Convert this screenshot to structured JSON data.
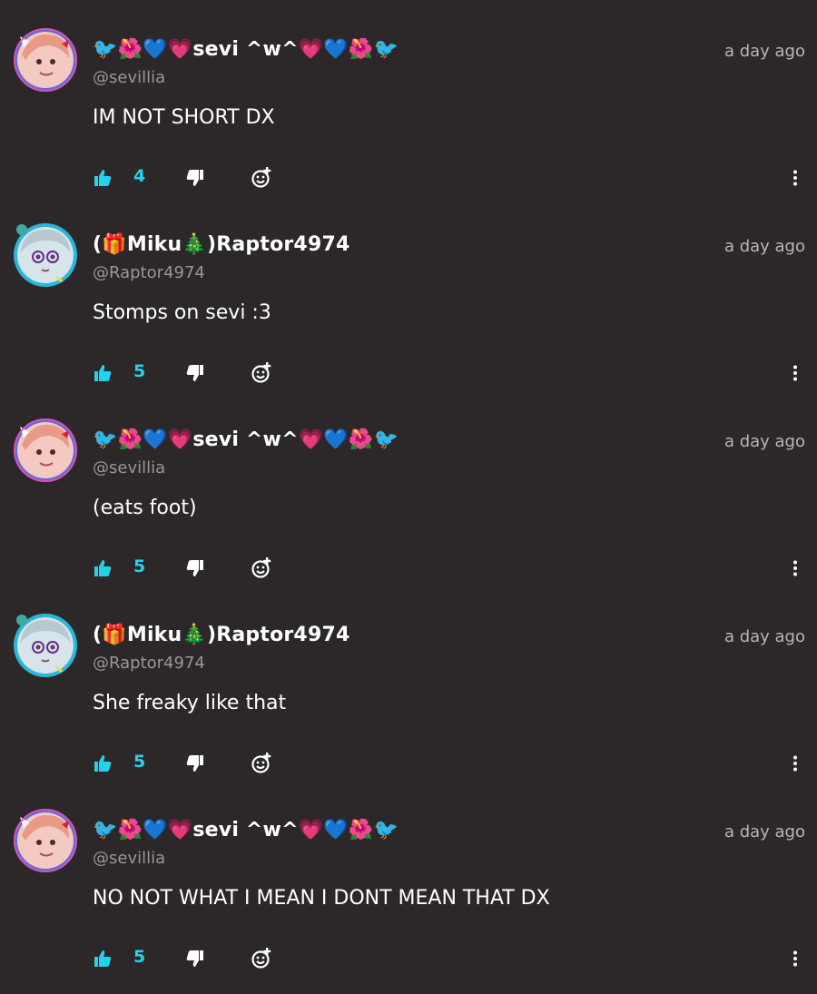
{
  "colors": {
    "background": "#2c2829",
    "accent": "#22d3ee",
    "muted_text": "#9a9596",
    "timestamp_text": "#b9b5b6"
  },
  "icons": {
    "like": "thumbs-up-icon",
    "dislike": "thumbs-down-icon",
    "react": "add-reaction-icon",
    "more": "more-vertical-icon"
  },
  "comments": [
    {
      "display_name": "🐦🌺💙💗sevi ^w^💗💙🌺🐦",
      "handle": "@sevillia",
      "timestamp": "a day ago",
      "text": "IM NOT SHORT DX",
      "likes": "4",
      "avatar": "sevi"
    },
    {
      "display_name": "(🎁Miku🎄)Raptor4974",
      "handle": "@Raptor4974",
      "timestamp": "a day ago",
      "text": "Stomps on sevi :3",
      "likes": "5",
      "avatar": "raptor"
    },
    {
      "display_name": "🐦🌺💙💗sevi ^w^💗💙🌺🐦",
      "handle": "@sevillia",
      "timestamp": "a day ago",
      "text": "(eats foot)",
      "likes": "5",
      "avatar": "sevi"
    },
    {
      "display_name": "(🎁Miku🎄)Raptor4974",
      "handle": "@Raptor4974",
      "timestamp": "a day ago",
      "text": "She freaky like that",
      "likes": "5",
      "avatar": "raptor"
    },
    {
      "display_name": "🐦🌺💙💗sevi ^w^💗💙🌺🐦",
      "handle": "@sevillia",
      "timestamp": "a day ago",
      "text": "NO NOT WHAT I MEAN I DONT MEAN THAT DX",
      "likes": "5",
      "avatar": "sevi"
    }
  ]
}
